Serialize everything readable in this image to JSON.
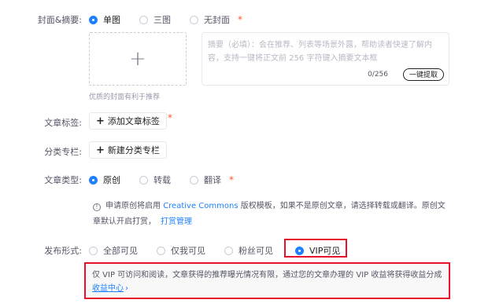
{
  "cover": {
    "label": "封面&摘要:",
    "options": [
      {
        "label": "单图",
        "checked": true
      },
      {
        "label": "三图",
        "checked": false
      },
      {
        "label": "无封面",
        "checked": false
      }
    ],
    "required_mark": "*",
    "tip": "优质的封面有利于推荐"
  },
  "summary": {
    "placeholder": "摘要（必填）：会在推荐、列表等场景外露，帮助读者快速了解内容，支持一键将正文前 256 字符键入摘要文本框",
    "count": "0/256",
    "extract_label": "一键提取"
  },
  "tags": {
    "label": "文章标签:",
    "add_label": "添加文章标签",
    "required_mark": "*"
  },
  "column": {
    "label": "分类专栏:",
    "add_label": "新建分类专栏"
  },
  "article_type": {
    "label": "文章类型:",
    "options": [
      {
        "label": "原创",
        "checked": true
      },
      {
        "label": "转载",
        "checked": false
      },
      {
        "label": "翻译",
        "checked": false
      }
    ],
    "required_mark": "*",
    "note_prefix": "申请原创将启用",
    "note_link": "Creative Commons",
    "note_suffix": "版权模板，如果不是原创文章，请选择转载或翻译。原创文章默认开启打赏，",
    "note_manage": "打赏管理"
  },
  "visibility": {
    "label": "发布形式:",
    "options": [
      {
        "label": "全部可见",
        "checked": false
      },
      {
        "label": "仅我可见",
        "checked": false
      },
      {
        "label": "粉丝可见",
        "checked": false
      },
      {
        "label": "VIP可见",
        "checked": true
      }
    ],
    "vip_note": "仅 VIP 可访问和阅读，文章获得的推荐曝光情况有限，通过您的文章办理的 VIP 收益将获得收益分成",
    "vip_link": "收益中心",
    "vip_link_arrow": "›"
  },
  "colors": {
    "accent": "#1e80ff",
    "required": "#fc5531",
    "highlight_border": "#e8122d"
  }
}
